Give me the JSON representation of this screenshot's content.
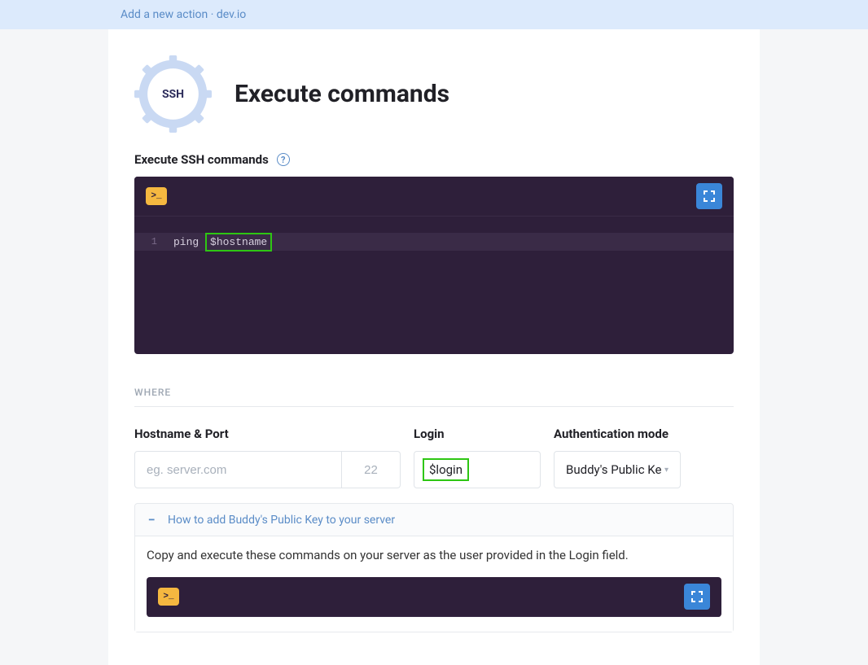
{
  "breadcrumb": "Add a new action · dev.io",
  "badge_text": "SSH",
  "page_title": "Execute commands",
  "commands_section_label": "Execute SSH commands",
  "editor": {
    "line_number": "1",
    "code_prefix": "ping ",
    "code_var": "$hostname"
  },
  "where_label": "WHERE",
  "host": {
    "label": "Hostname & Port",
    "placeholder": "eg. server.com",
    "port": "22"
  },
  "login": {
    "label": "Login",
    "value": "$login"
  },
  "auth": {
    "label": "Authentication mode",
    "selected": "Buddy's Public Ke"
  },
  "accordion": {
    "title": "How to add Buddy's Public Key to your server",
    "body": "Copy and execute these commands on your server as the user provided in the Login field."
  }
}
